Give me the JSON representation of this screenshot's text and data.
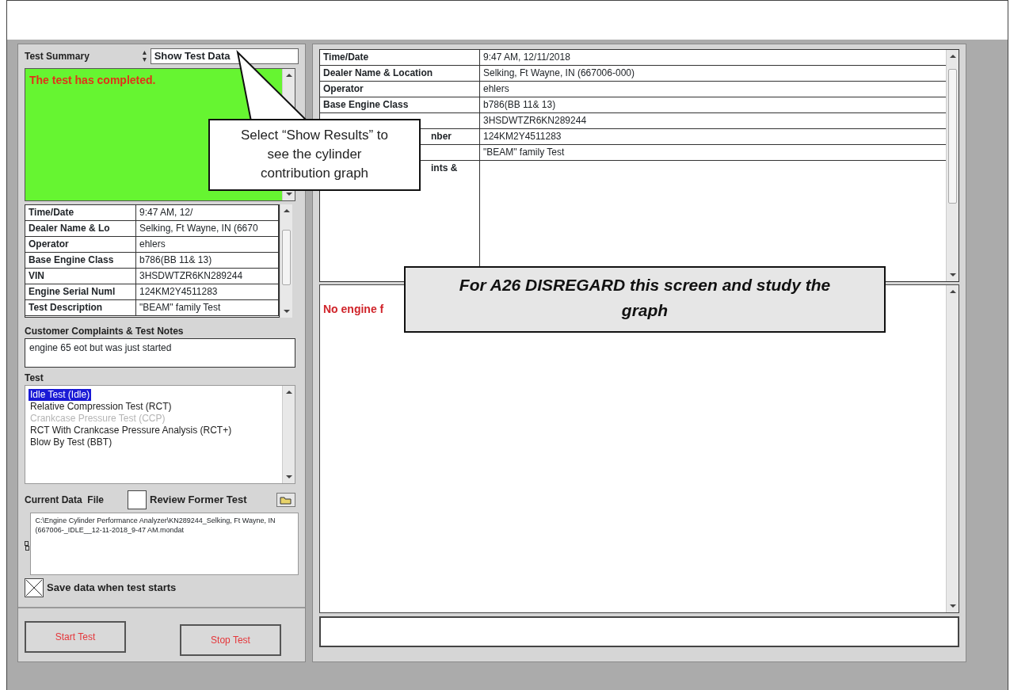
{
  "summary": {
    "label": "Test Summary",
    "view_selector": "Show Test Data",
    "status": "The test has completed."
  },
  "info_table": {
    "rows": [
      {
        "label": "Time/Date",
        "value": "9:47 AM, 12/"
      },
      {
        "label": "Dealer Name & Lo",
        "value": "Selking, Ft Wayne, IN (6670"
      },
      {
        "label": "Operator",
        "value": "ehlers"
      },
      {
        "label": "Base Engine Class",
        "value": "b786(BB 11& 13)"
      },
      {
        "label": "VIN",
        "value": "3HSDWTZR6KN289244"
      },
      {
        "label": "Engine Serial Numl",
        "value": "124KM2Y4511283"
      },
      {
        "label": "Test Description",
        "value": "\"BEAM\" family Test"
      }
    ]
  },
  "notes": {
    "label": "Customer Complaints & Test Notes",
    "value": "engine 65 eot but was just started"
  },
  "tests": {
    "label": "Test",
    "items": [
      {
        "text": "Idle Test (Idle)",
        "selected": true,
        "disabled": false
      },
      {
        "text": "Relative Compression Test (RCT)",
        "selected": false,
        "disabled": false
      },
      {
        "text": "Crankcase Pressure Test (CCP)",
        "selected": false,
        "disabled": true
      },
      {
        "text": "RCT With Crankcase Pressure Analysis (RCT+)",
        "selected": false,
        "disabled": false
      },
      {
        "text": "Blow By Test (BBT)",
        "selected": false,
        "disabled": false
      }
    ]
  },
  "data_file": {
    "label": "Current Data  File",
    "review_label": "Review Former Test",
    "review_checked": false,
    "path": "C:\\Engine Cylinder Performance Analyzer\\KN289244_Selking, Ft Wayne, IN (667006-_IDLE__12-11-2018_9-47 AM.mondat"
  },
  "save": {
    "label": "Save data when test starts",
    "checked": true
  },
  "buttons": [
    "Start Test",
    "Stop Test"
  ],
  "detail_table": {
    "rows": [
      {
        "label": "Time/Date",
        "value": "9:47 AM, 12/11/2018",
        "clipped": false
      },
      {
        "label": "Dealer Name & Location",
        "value": "Selking, Ft Wayne, IN (667006-000)",
        "clipped": false
      },
      {
        "label": "Operator",
        "value": "ehlers",
        "clipped": false
      },
      {
        "label": "Base Engine Class",
        "value": "b786(BB 11& 13)",
        "clipped": false
      },
      {
        "value": "3HSDWTZR6KN289244"
      },
      {
        "label": "nber",
        "value": "124KM2Y4511283",
        "clipped": true
      },
      {
        "value": "\"BEAM\" family Test"
      },
      {
        "label": "ints &",
        "clipped": true
      }
    ]
  },
  "results": {
    "text": "No engine f"
  },
  "callouts": [
    {
      "kind": "speech",
      "text": "Select “Show Results” to see the cylinder contribution graph"
    },
    {
      "kind": "banner",
      "text": "For A26 DISREGARD this screen and study the graph"
    }
  ]
}
